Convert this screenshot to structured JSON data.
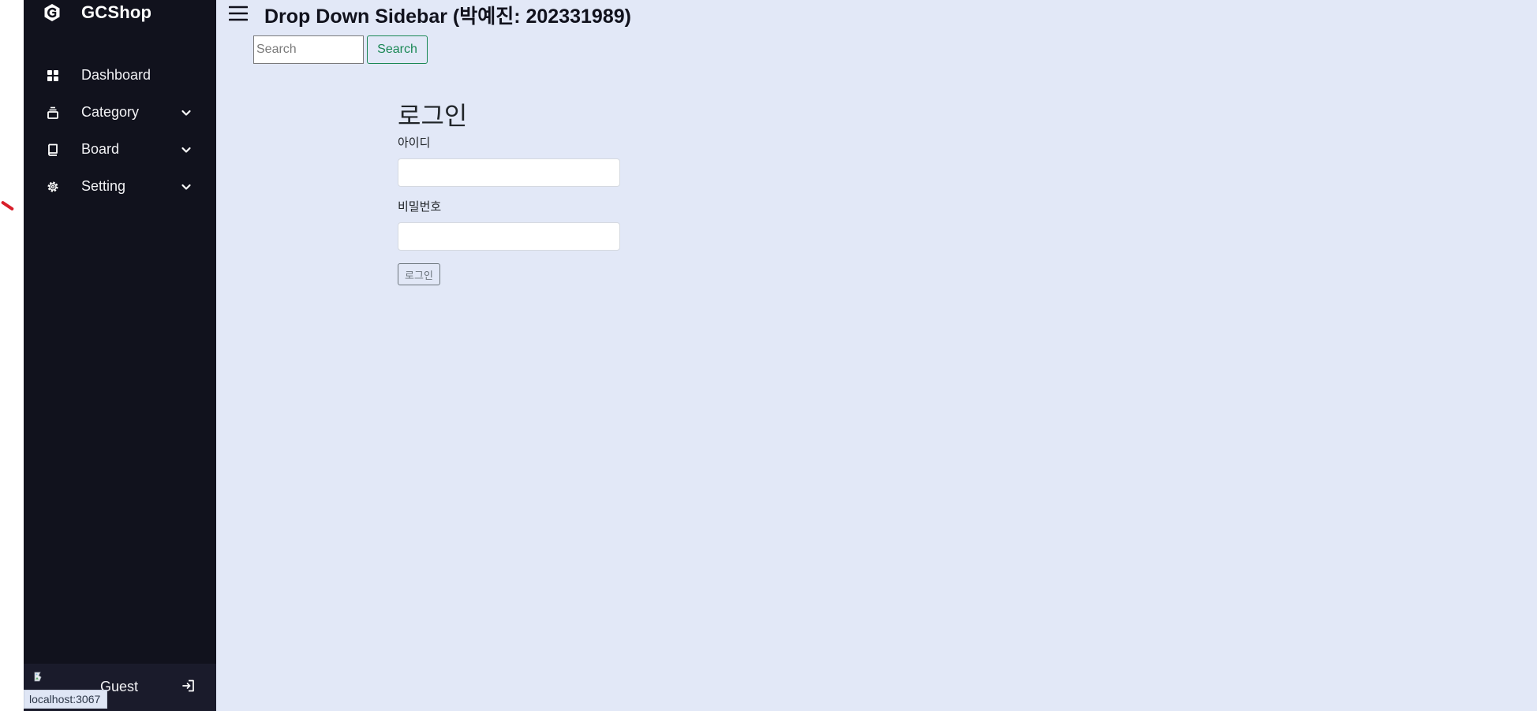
{
  "app": {
    "brand_name": "GCShop",
    "brand_logo": "gc-logo-icon"
  },
  "sidebar": {
    "items": [
      {
        "label": "Dashboard",
        "icon": "dashboard-grid-icon",
        "has_dropdown": false
      },
      {
        "label": "Category",
        "icon": "category-stack-icon",
        "has_dropdown": true
      },
      {
        "label": "Board",
        "icon": "book-icon",
        "has_dropdown": true
      },
      {
        "label": "Setting",
        "icon": "gear-icon",
        "has_dropdown": true
      }
    ],
    "footer": {
      "user_name": "Guest",
      "avatar_icon": "broken-image-icon",
      "logout_icon": "logout-icon"
    }
  },
  "header": {
    "menu_icon": "hamburger-icon",
    "title": "Drop Down Sidebar (박예진: 202331989)"
  },
  "search": {
    "placeholder": "Search",
    "value": "",
    "button_label": "Search"
  },
  "login": {
    "heading": "로그인",
    "id_label": "아이디",
    "id_value": "",
    "password_label": "비밀번호",
    "password_value": "",
    "submit_label": "로그인"
  },
  "status_bar": {
    "url": "localhost:3067"
  },
  "colors": {
    "sidebar_bg": "#11121d",
    "main_bg": "#e2e8f7",
    "search_button": "#198754",
    "login_button": "#6c757d"
  }
}
